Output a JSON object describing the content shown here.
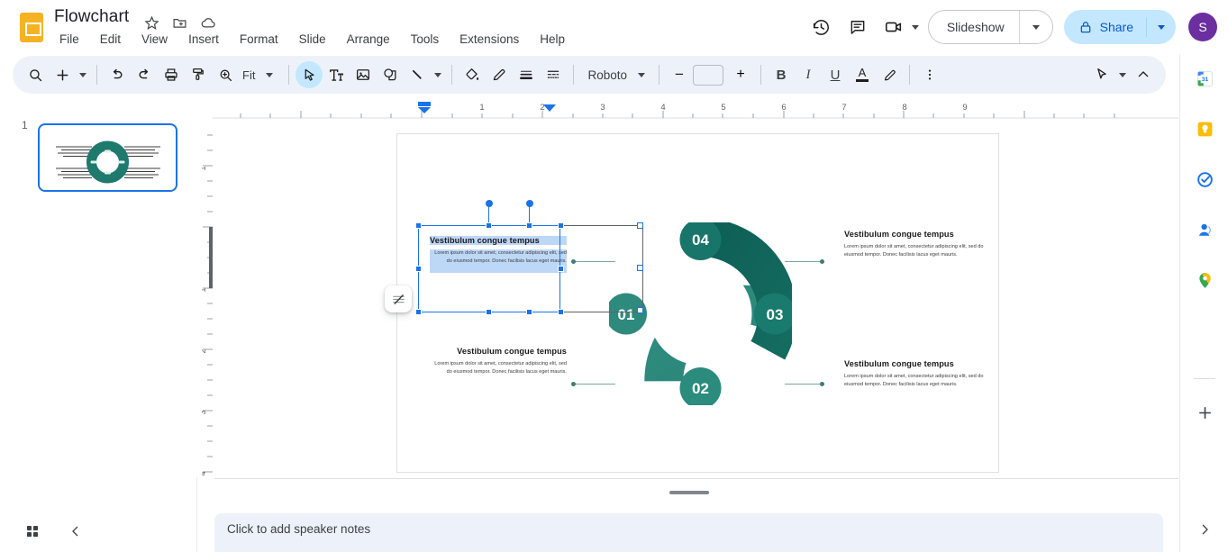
{
  "header": {
    "doc_title": "Flowchart",
    "doc_icon": "slides-icon",
    "star_icon": "star-icon",
    "move_icon": "move-to-folder-icon",
    "cloud_icon": "cloud-saved-icon",
    "menus": [
      "File",
      "Edit",
      "View",
      "Insert",
      "Format",
      "Slide",
      "Arrange",
      "Tools",
      "Extensions",
      "Help"
    ],
    "history_icon": "version-history-icon",
    "comment_icon": "comment-icon",
    "meet_icon": "meet-camera-icon",
    "slideshow_label": "Slideshow",
    "share_label": "Share",
    "share_lock_icon": "lock-icon",
    "avatar_initial": "S",
    "accent_blue": "#0b57d0",
    "share_bg": "#c2e7ff"
  },
  "toolbar": {
    "search_icon": "search-icon",
    "new_slide_icon": "plus-icon",
    "undo_icon": "undo-icon",
    "redo_icon": "redo-icon",
    "print_icon": "print-icon",
    "paint_format_icon": "paint-format-icon",
    "zoom_icon": "zoom-icon",
    "zoom_level": "Fit",
    "select_icon": "cursor-select-icon",
    "textbox_icon": "text-box-icon",
    "image_icon": "insert-image-icon",
    "shape_icon": "shape-icon",
    "line_icon": "line-icon",
    "fill_icon": "fill-color-icon",
    "border_color_icon": "border-color-icon",
    "border_weight_icon": "border-weight-icon",
    "border_dash_icon": "border-dash-icon",
    "font_name": "Roboto",
    "font_size": "",
    "decrease_font_label": "−",
    "increase_font_label": "+",
    "bold_label": "B",
    "italic_label": "I",
    "underline_label": "U",
    "text_color_label": "A",
    "highlight_icon": "highlight-pen-icon",
    "more_icon": "more-options-icon",
    "pointer_icon": "laser-pointer-icon",
    "collapse_icon": "collapse-toolbar-icon"
  },
  "filmstrip": {
    "slide_number": "1"
  },
  "rulers": {
    "horizontal_ticks": [
      "1",
      "2",
      "3",
      "4",
      "5",
      "6",
      "7",
      "8",
      "9"
    ],
    "vertical_ticks": [
      "1",
      "1",
      "2",
      "3",
      "4"
    ]
  },
  "slide": {
    "donut": {
      "segments": [
        {
          "id": "01",
          "label": "01",
          "color": "#2c8a7c"
        },
        {
          "id": "02",
          "label": "02",
          "color": "#2c8a7c"
        },
        {
          "id": "03",
          "label": "03",
          "color": "#11665d"
        },
        {
          "id": "04",
          "label": "04",
          "color": "#11665d"
        }
      ],
      "knob_color": "#35998a"
    },
    "text_blocks": [
      {
        "position": "top-left",
        "heading": "Vestibulum congue tempus",
        "body": "Lorem ipsum dolor sit amet, consectetur adipiscing elit, sed do eiusmod tempor. Donec facilisis lacus eget mauris.",
        "selected": true
      },
      {
        "position": "top-right",
        "heading": "Vestibulum congue tempus",
        "body": "Lorem ipsum dolor sit amet, consectetur adipiscing elit, sed do eiusmod tempor. Donec facilisis lacus eget mauris.",
        "selected": false
      },
      {
        "position": "bottom-left",
        "heading": "Vestibulum congue tempus",
        "body": "Lorem ipsum dolor sit amet, consectetur adipiscing elit, sed do eiusmod tempor. Donec facilisis lacus eget mauris.",
        "selected": false
      },
      {
        "position": "bottom-right",
        "heading": "Vestibulum congue tempus",
        "body": "Lorem ipsum dolor sit amet, consectetur adipiscing elit, sed do eiusmod tempor. Donec facilisis lacus eget mauris.",
        "selected": false
      }
    ],
    "float_button_icon": "format-options-icon"
  },
  "notes": {
    "placeholder": "Click to add speaker notes"
  },
  "bottom_bar": {
    "grid_view_icon": "grid-view-icon",
    "collapse_filmstrip_icon": "chevron-left-icon"
  },
  "right_rail": {
    "items": [
      {
        "name": "google-calendar-icon",
        "label": "Calendar"
      },
      {
        "name": "google-keep-icon",
        "label": "Keep"
      },
      {
        "name": "google-tasks-icon",
        "label": "Tasks"
      },
      {
        "name": "google-contacts-icon",
        "label": "Contacts"
      },
      {
        "name": "google-maps-icon",
        "label": "Maps"
      }
    ],
    "add_on_icon": "plus-icon",
    "expand_icon": "chevron-right-icon"
  }
}
